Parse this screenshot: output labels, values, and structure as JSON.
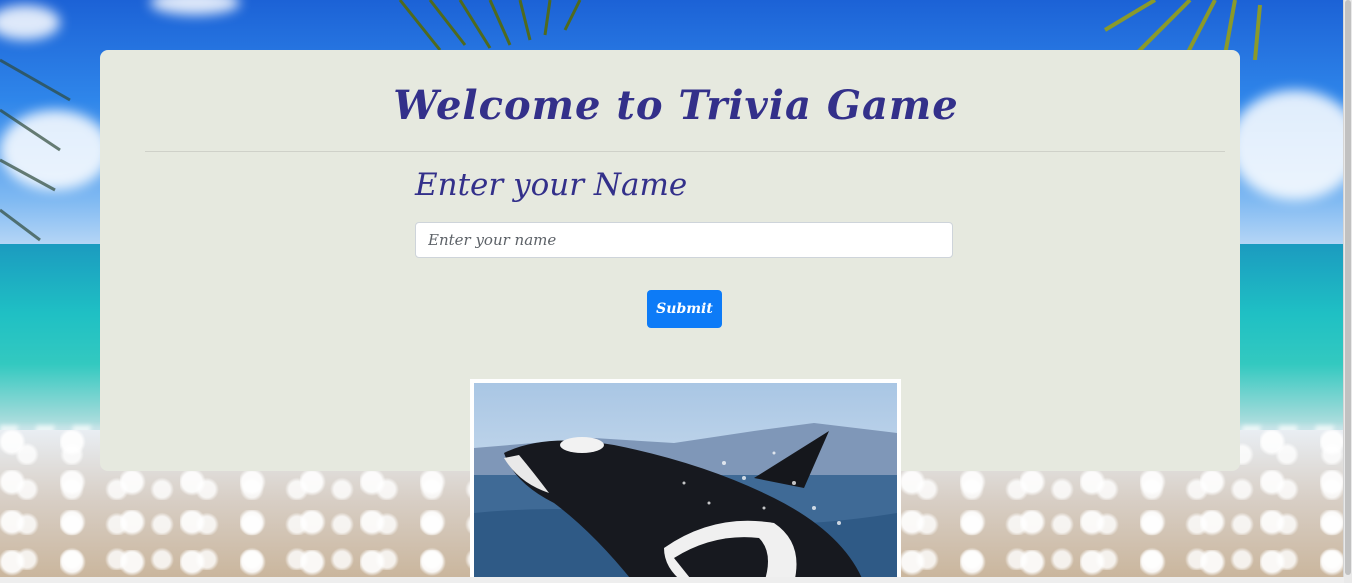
{
  "page": {
    "title": "Welcome to Trivia Game",
    "subtitle": "Enter your Name"
  },
  "form": {
    "name_placeholder": "Enter your name",
    "name_value": "",
    "submit_label": "Submit"
  },
  "image": {
    "subject": "orca-whale"
  },
  "colors": {
    "title": "#33308a",
    "card": "#e6e9df",
    "button": "#0d7bf7"
  }
}
